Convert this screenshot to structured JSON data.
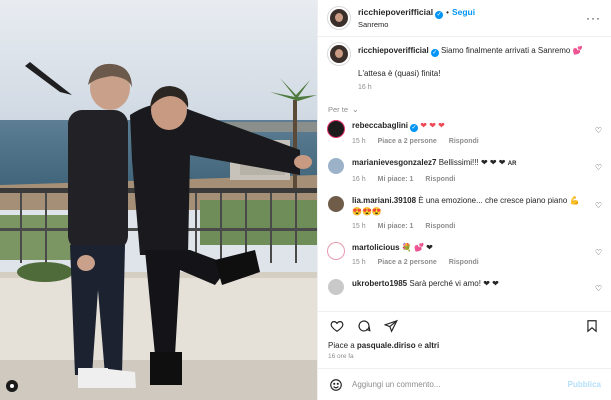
{
  "post": {
    "username": "ricchiepoverifficial",
    "follow_label": "Segui",
    "location": "Sanremo",
    "caption": {
      "username": "ricchiepoverifficial",
      "line1": "Siamo finalmente arrivati a Sanremo",
      "line2": "L'attesa è (quasi) finita!",
      "time": "16 h"
    },
    "see_more_label": "Per te"
  },
  "comments": [
    {
      "username": "rebeccabaglini",
      "text": "❤ ❤ ❤",
      "time": "15 h",
      "likes": "Piace a 2 persone",
      "reply": "Rispondi",
      "avatar_color": "#1b1b1b"
    },
    {
      "username": "marianievesgonzalez7",
      "text": "Bellissimi!!! ❤ ❤ ❤",
      "flag": "AR",
      "time": "16 h",
      "likes": "Mi piace: 1",
      "reply": "Rispondi",
      "avatar_color": "#9bb2c9"
    },
    {
      "username": "lia.mariani.39108",
      "text": "È una emozione... che cresce piano piano",
      "text2": "😍😍😍",
      "time": "15 h",
      "likes": "Mi piace: 1",
      "reply": "Rispondi",
      "avatar_color": "#6f5d4a"
    },
    {
      "username": "martolicious",
      "text": "💐 💕 ❤",
      "time": "15 h",
      "likes": "Piace a 2 persone",
      "reply": "Rispondi",
      "avatar_color": "#e89bb0"
    },
    {
      "username": "ukroberto1985",
      "text": "Sarà perché vi amo! ❤ ❤",
      "time": "",
      "likes": "",
      "reply": "",
      "avatar_color": "#c9c9c9"
    }
  ],
  "likes": {
    "prefix": "Piace a",
    "user": "pasquale.diriso",
    "connector": "e",
    "others": "altri"
  },
  "time_ago": "16 ore fa",
  "add_comment": {
    "placeholder": "Aggiungi un commento...",
    "publish_label": "Pubblica"
  },
  "colors": {
    "accent": "#0095f6",
    "heart": "#ed4956",
    "muted": "#8e8e8e"
  }
}
